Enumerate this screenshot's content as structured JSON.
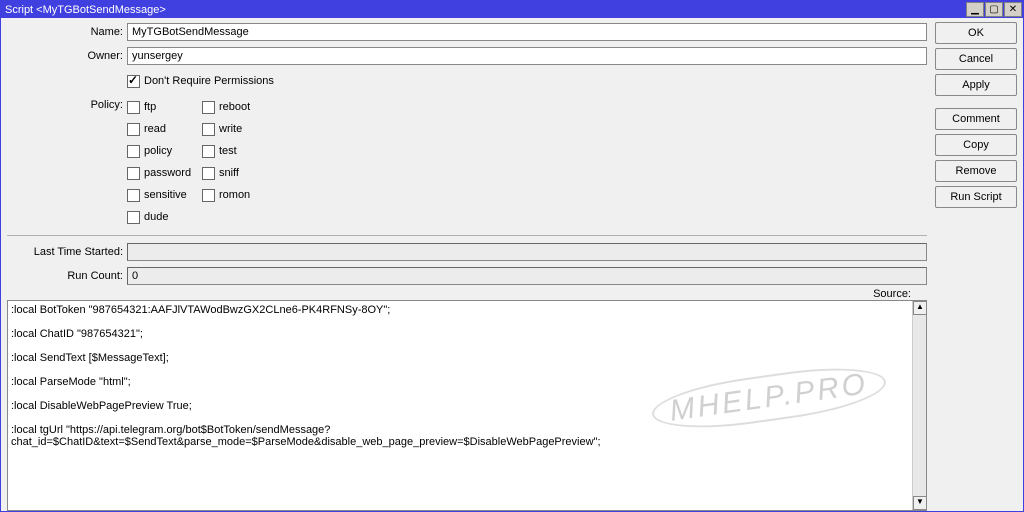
{
  "window": {
    "title": "Script <MyTGBotSendMessage>"
  },
  "labels": {
    "name": "Name:",
    "owner": "Owner:",
    "policy": "Policy:",
    "dont_require": "Don't Require Permissions",
    "last_time": "Last Time Started:",
    "run_count": "Run Count:",
    "source": "Source:"
  },
  "fields": {
    "name": "MyTGBotSendMessage",
    "owner": "yunsergey",
    "last_time": "",
    "run_count": "0"
  },
  "policies": {
    "col1": [
      "ftp",
      "read",
      "policy",
      "password",
      "sensitive",
      "dude"
    ],
    "col2": [
      "reboot",
      "write",
      "test",
      "sniff",
      "romon"
    ]
  },
  "buttons": {
    "ok": "OK",
    "cancel": "Cancel",
    "apply": "Apply",
    "comment": "Comment",
    "copy": "Copy",
    "remove": "Remove",
    "run": "Run Script"
  },
  "titlebar_icons": {
    "min": "▁",
    "max": "▢",
    "close": "✕"
  },
  "source_text": ":local BotToken \"987654321:AAFJlVTAWodBwzGX2CLne6-PK4RFNSy-8OY\";\n\n:local ChatID \"987654321\";\n\n:local SendText [$MessageText];\n\n:local ParseMode \"html\";\n\n:local DisableWebPagePreview True;\n\n:local tgUrl \"https://api.telegram.org/bot$BotToken/sendMessage?chat_id=$ChatID&text=$SendText&parse_mode=$ParseMode&disable_web_page_preview=$DisableWebPagePreview\";",
  "watermark": "MHELP.PRO"
}
